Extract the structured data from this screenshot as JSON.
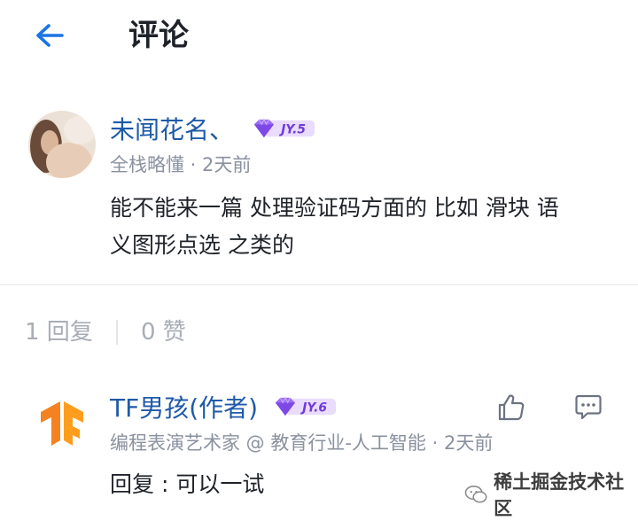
{
  "header": {
    "title": "评论",
    "back_icon": "arrow-left-icon",
    "accent_color": "#1b74e4"
  },
  "comment": {
    "username": "未闻花名、",
    "level": "JY.5",
    "meta": "全栈略懂 · 2天前",
    "content_line1": "能不能来一篇 处理验证码方面的 比如 滑块 语",
    "content_line2": "义图形点选 之类的"
  },
  "stats": {
    "replies": "1 回复",
    "likes": "0 赞"
  },
  "reply": {
    "username": "TF男孩(作者)",
    "level": "JY.6",
    "meta": "编程表演艺术家 @ 教育行业-人工智能 · 2天前",
    "content": "回复 : 可以一试",
    "like_icon": "thumbs-up-icon",
    "reply_icon": "comment-icon"
  },
  "watermark": {
    "text": "稀土掘金技术社区"
  }
}
